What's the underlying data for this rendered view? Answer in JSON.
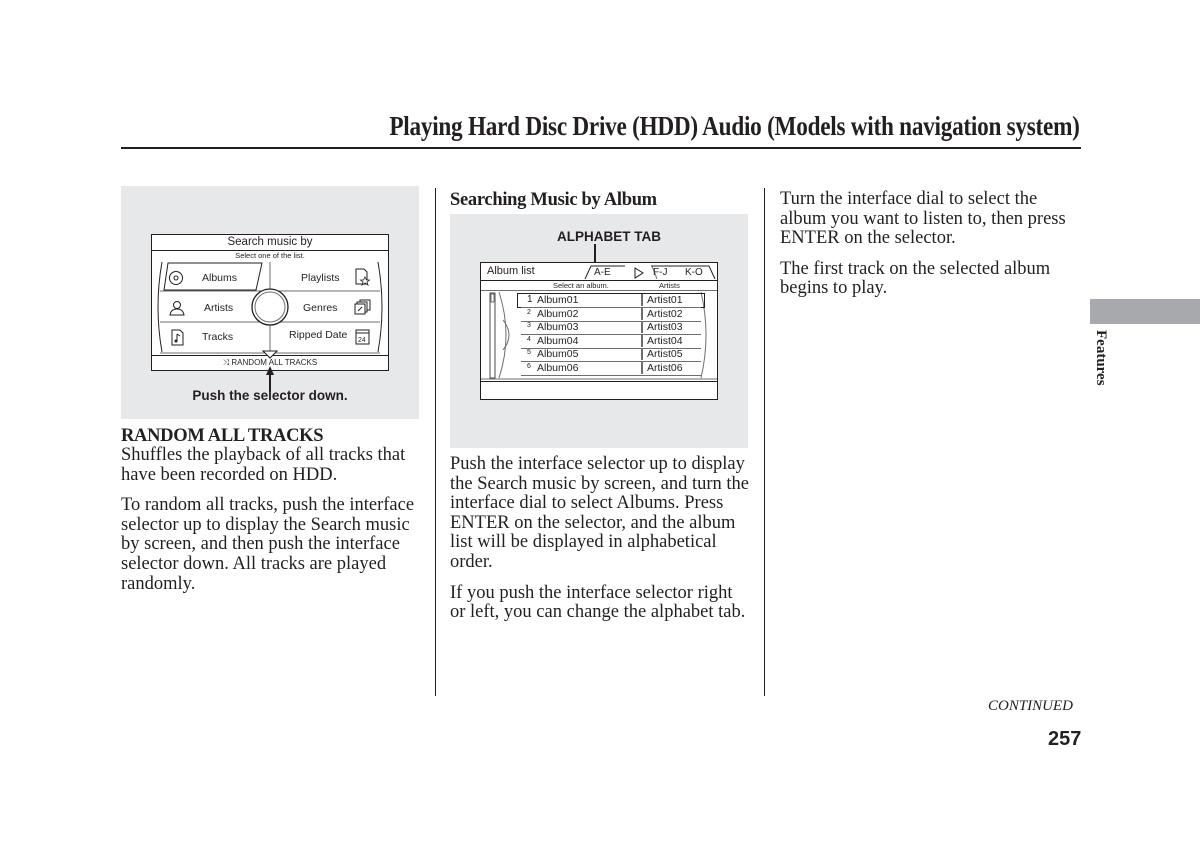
{
  "page": {
    "title": "Playing Hard Disc Drive (HDD) Audio (Models with navigation system)",
    "side_tab": "Features",
    "continued": "CONTINUED",
    "page_number": "257"
  },
  "figure1": {
    "screen_title": "Search music by",
    "screen_subtitle": "Select one of the list.",
    "options": [
      {
        "label": "Albums",
        "icon": "disc-icon"
      },
      {
        "label": "Playlists",
        "icon": "playlist-star-icon"
      },
      {
        "label": "Artists",
        "icon": "person-icon"
      },
      {
        "label": "Genres",
        "icon": "genres-folders-icon"
      },
      {
        "label": "Tracks",
        "icon": "music-note-file-icon"
      },
      {
        "label": "Ripped Date",
        "icon": "calendar-icon"
      }
    ],
    "footer": "RANDOM ALL TRACKS",
    "footer_icon": "shuffle-icon",
    "caption": "Push the selector down."
  },
  "col1": {
    "heading": "RANDOM ALL TRACKS",
    "paragraphs": [
      "Shuffles the playback of all tracks that have been recorded on HDD.",
      "To random all tracks, push the interface selector up to display the Search music by screen, and then push the interface selector down. All tracks are played randomly."
    ]
  },
  "col2": {
    "heading": "Searching Music by Album",
    "paragraphs": [
      "Push the interface selector up to display the Search music by screen, and turn the interface dial to select Albums. Press ENTER on the selector, and the album list will be displayed in alphabetical order.",
      "If you push the interface selector right or left, you can change the alphabet tab."
    ]
  },
  "figure2": {
    "callout": "ALPHABET TAB",
    "screen_title": "Album list",
    "tabs": [
      "A-E",
      "F-J",
      "K-O"
    ],
    "col_header_album": "Select an album.",
    "col_header_artist": "Artists",
    "rows": [
      {
        "num": "1",
        "album": "Album01",
        "artist": "Artist01"
      },
      {
        "num": "2",
        "album": "Album02",
        "artist": "Artist02"
      },
      {
        "num": "3",
        "album": "Album03",
        "artist": "Artist03"
      },
      {
        "num": "4",
        "album": "Album04",
        "artist": "Artist04"
      },
      {
        "num": "5",
        "album": "Album05",
        "artist": "Artist05"
      },
      {
        "num": "6",
        "album": "Album06",
        "artist": "Artist06"
      }
    ]
  },
  "col3": {
    "paragraphs": [
      "Turn the interface dial to select the album you want to listen to, then press ENTER on the selector.",
      "The first track on the selected album begins to play."
    ]
  }
}
